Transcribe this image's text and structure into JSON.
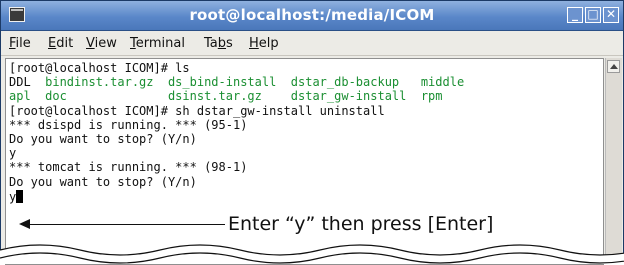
{
  "window": {
    "title": "root@localhost:/media/ICOM",
    "controls": {
      "minimize": "_",
      "maximize": "□",
      "close": "✕"
    }
  },
  "menu": [
    {
      "mnemonic": "F",
      "rest": "ile"
    },
    {
      "mnemonic": "E",
      "rest": "dit"
    },
    {
      "mnemonic": "V",
      "rest": "iew"
    },
    {
      "mnemonic": "T",
      "rest": "erminal"
    },
    {
      "pre": "Ta",
      "mnemonic": "b",
      "rest": "s"
    },
    {
      "mnemonic": "H",
      "rest": "elp"
    }
  ],
  "terminal": {
    "lines": [
      {
        "segments": [
          {
            "text": "[root@localhost ICOM]# ls",
            "color": "default"
          }
        ]
      },
      {
        "segments": [
          {
            "text": "DDL",
            "color": "default"
          },
          {
            "text": "  bindinst.tar.gz  ds_bind-install  dstar_db-backup   middle",
            "color": "green"
          }
        ]
      },
      {
        "segments": [
          {
            "text": "apl  doc",
            "color": "green"
          },
          {
            "text": "              ",
            "color": "default"
          },
          {
            "text": "dsinst.tar.gz    dstar_gw-install  rpm",
            "color": "green"
          }
        ]
      },
      {
        "segments": [
          {
            "text": "[root@localhost ICOM]# sh dstar_gw-install uninstall",
            "color": "default"
          }
        ]
      },
      {
        "segments": [
          {
            "text": "*** dsispd is running. *** (95-1)",
            "color": "default"
          }
        ]
      },
      {
        "segments": [
          {
            "text": "Do you want to stop? (Y/n)",
            "color": "default"
          }
        ]
      },
      {
        "segments": [
          {
            "text": "y",
            "color": "default"
          }
        ]
      },
      {
        "segments": [
          {
            "text": "*** tomcat is running. *** (98-1)",
            "color": "default"
          }
        ]
      },
      {
        "segments": [
          {
            "text": "Do you want to stop? (Y/n)",
            "color": "default"
          }
        ]
      },
      {
        "segments": [
          {
            "text": "y",
            "color": "default"
          }
        ],
        "cursor": true
      }
    ]
  },
  "callout": {
    "text": "Enter “y” then press [Enter]"
  },
  "colors": {
    "title_bar": "#5a87c9",
    "ls_directory_green": "#1b8f32",
    "terminal_bg": "#ffffff"
  }
}
